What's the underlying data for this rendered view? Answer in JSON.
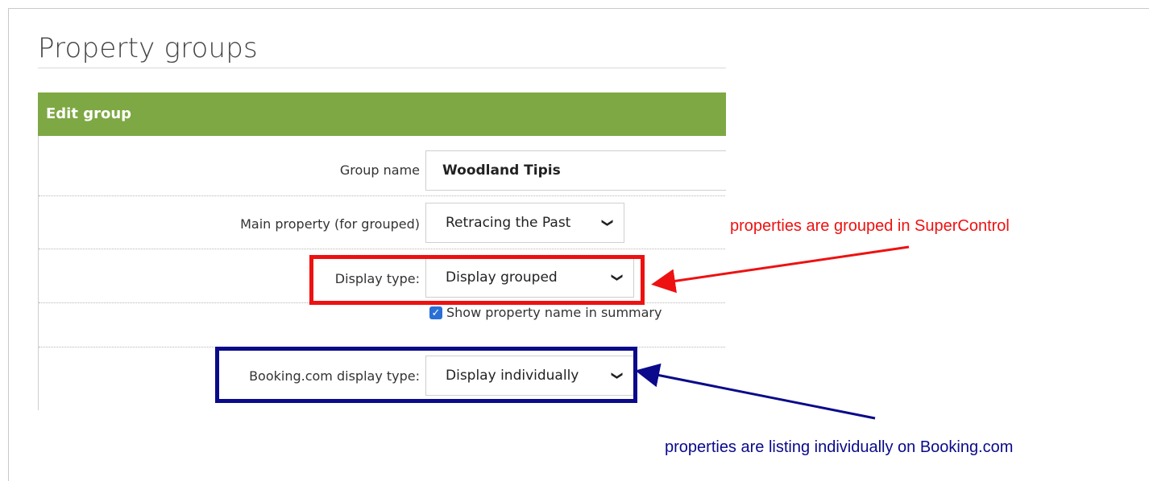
{
  "page": {
    "title": "Property groups"
  },
  "panel": {
    "header": "Edit group",
    "fields": {
      "group_name": {
        "label": "Group name",
        "value": "Woodland Tipis"
      },
      "main_property": {
        "label": "Main property (for grouped)",
        "value": "Retracing the Past"
      },
      "display_type": {
        "label": "Display type:",
        "value": "Display grouped"
      },
      "show_property_name": {
        "label": "Show property name in summary",
        "checked": true
      },
      "booking_display_type": {
        "label": "Booking.com display type:",
        "value": "Display individually"
      }
    }
  },
  "annotations": {
    "red_note": "properties are grouped in SuperControl",
    "blue_note": "properties are listing individually on Booking.com"
  },
  "colors": {
    "header_green": "#7ea844",
    "highlight_red": "#ee1111",
    "highlight_blue": "#0a0a8a",
    "checkbox_blue": "#2a6fd6"
  },
  "icons": {
    "select_arrow": "chevron-down-icon",
    "checkbox": "checkmark-icon"
  }
}
